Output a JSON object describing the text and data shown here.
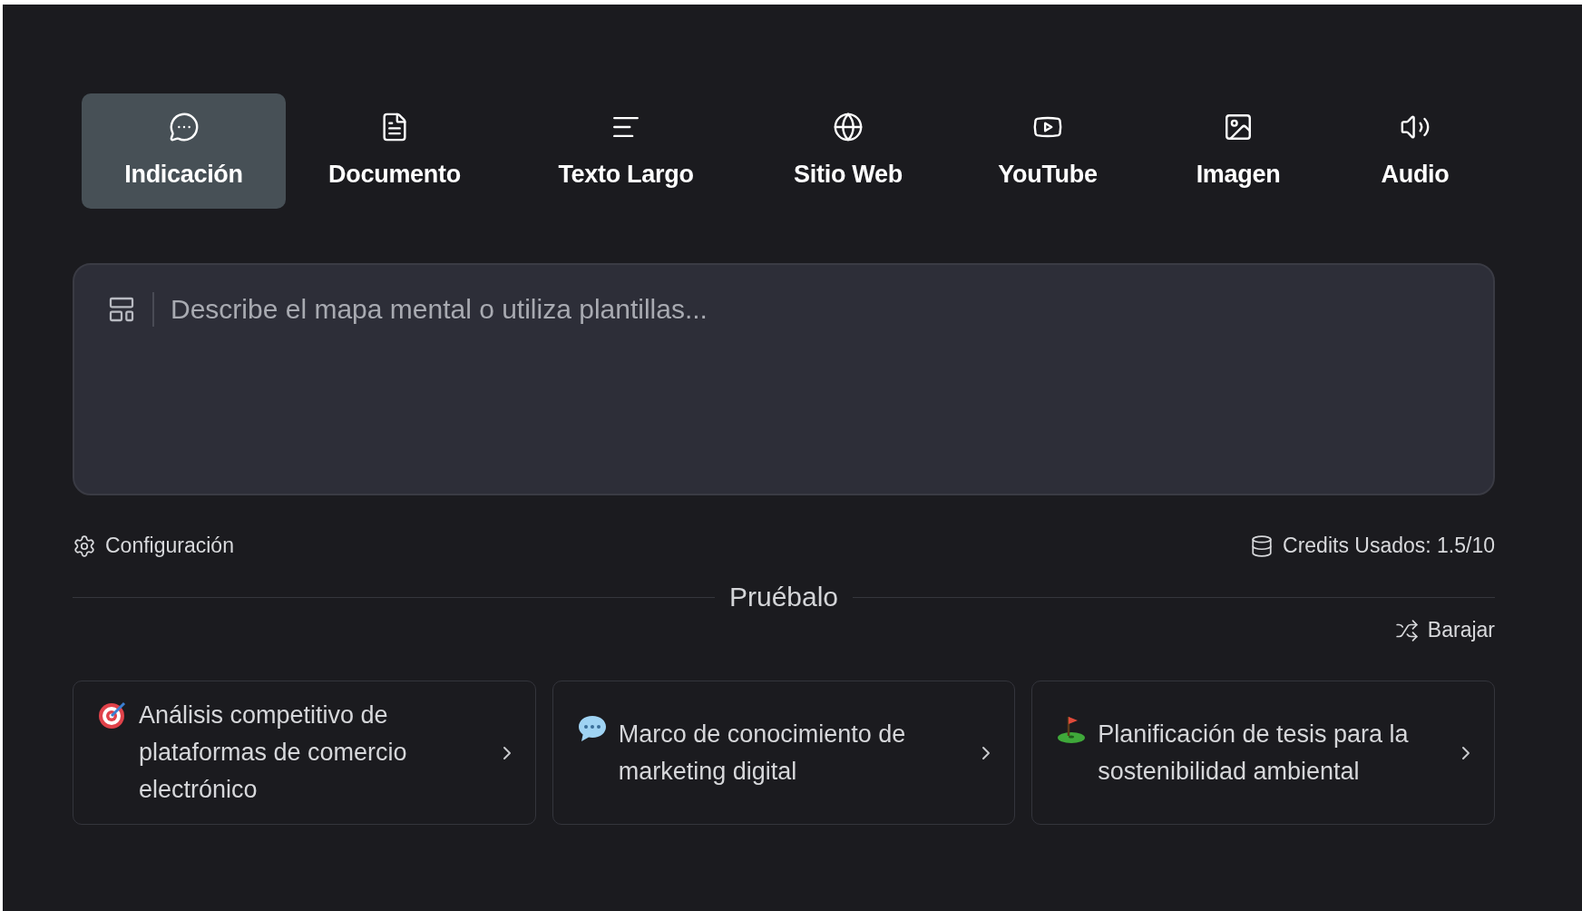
{
  "tabs": [
    {
      "label": "Indicación",
      "selected": true
    },
    {
      "label": "Documento",
      "selected": false
    },
    {
      "label": "Texto Largo",
      "selected": false
    },
    {
      "label": "Sitio Web",
      "selected": false
    },
    {
      "label": "YouTube",
      "selected": false
    },
    {
      "label": "Imagen",
      "selected": false
    },
    {
      "label": "Audio",
      "selected": false
    }
  ],
  "prompt": {
    "placeholder": "Describe el mapa mental o utiliza plantillas..."
  },
  "settings_link": "Configuración",
  "credits": "Credits Usados: 1.5/10",
  "try_section": {
    "title": "Pruébalo",
    "shuffle": "Barajar"
  },
  "suggestions": [
    {
      "text": "Análisis competitivo de plataformas de comercio electrónico"
    },
    {
      "text": "Marco de conocimiento de marketing digital"
    },
    {
      "text": "Planificación de tesis para la sostenibilidad ambiental"
    }
  ]
}
